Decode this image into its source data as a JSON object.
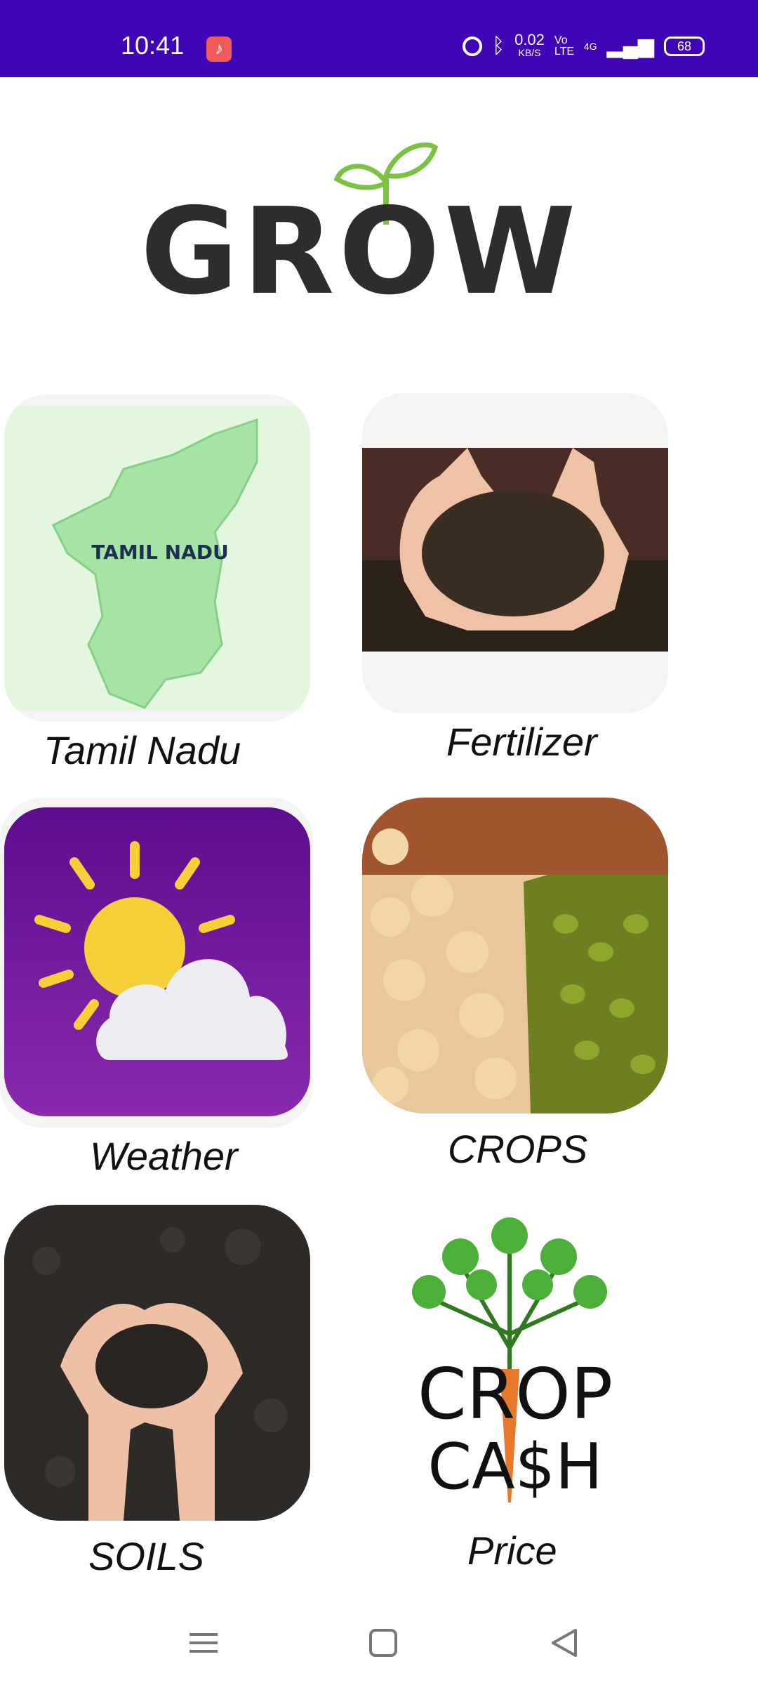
{
  "status_bar": {
    "time": "10:41",
    "network_speed_value": "0.02",
    "network_speed_unit": "KB/S",
    "volte": "Vo LTE",
    "network_type": "4G",
    "battery": "68"
  },
  "logo": {
    "text": "GROW"
  },
  "tiles": [
    {
      "label": "Tamil Nadu",
      "image_text": "TAMIL NADU"
    },
    {
      "label": "Fertilizer"
    },
    {
      "label": "Weather"
    },
    {
      "label": "CROPS"
    },
    {
      "label": "SOILS"
    },
    {
      "label": "Price",
      "image_text_line1": "CROP",
      "image_text_line2": "CA$H"
    }
  ],
  "nav": {
    "menu_icon": "menu-icon",
    "home_icon": "home-icon",
    "back_icon": "back-icon"
  },
  "colors": {
    "status_bar": "#3f06b5",
    "logo_dark": "#2d2d2d",
    "logo_green": "#7cc242"
  }
}
